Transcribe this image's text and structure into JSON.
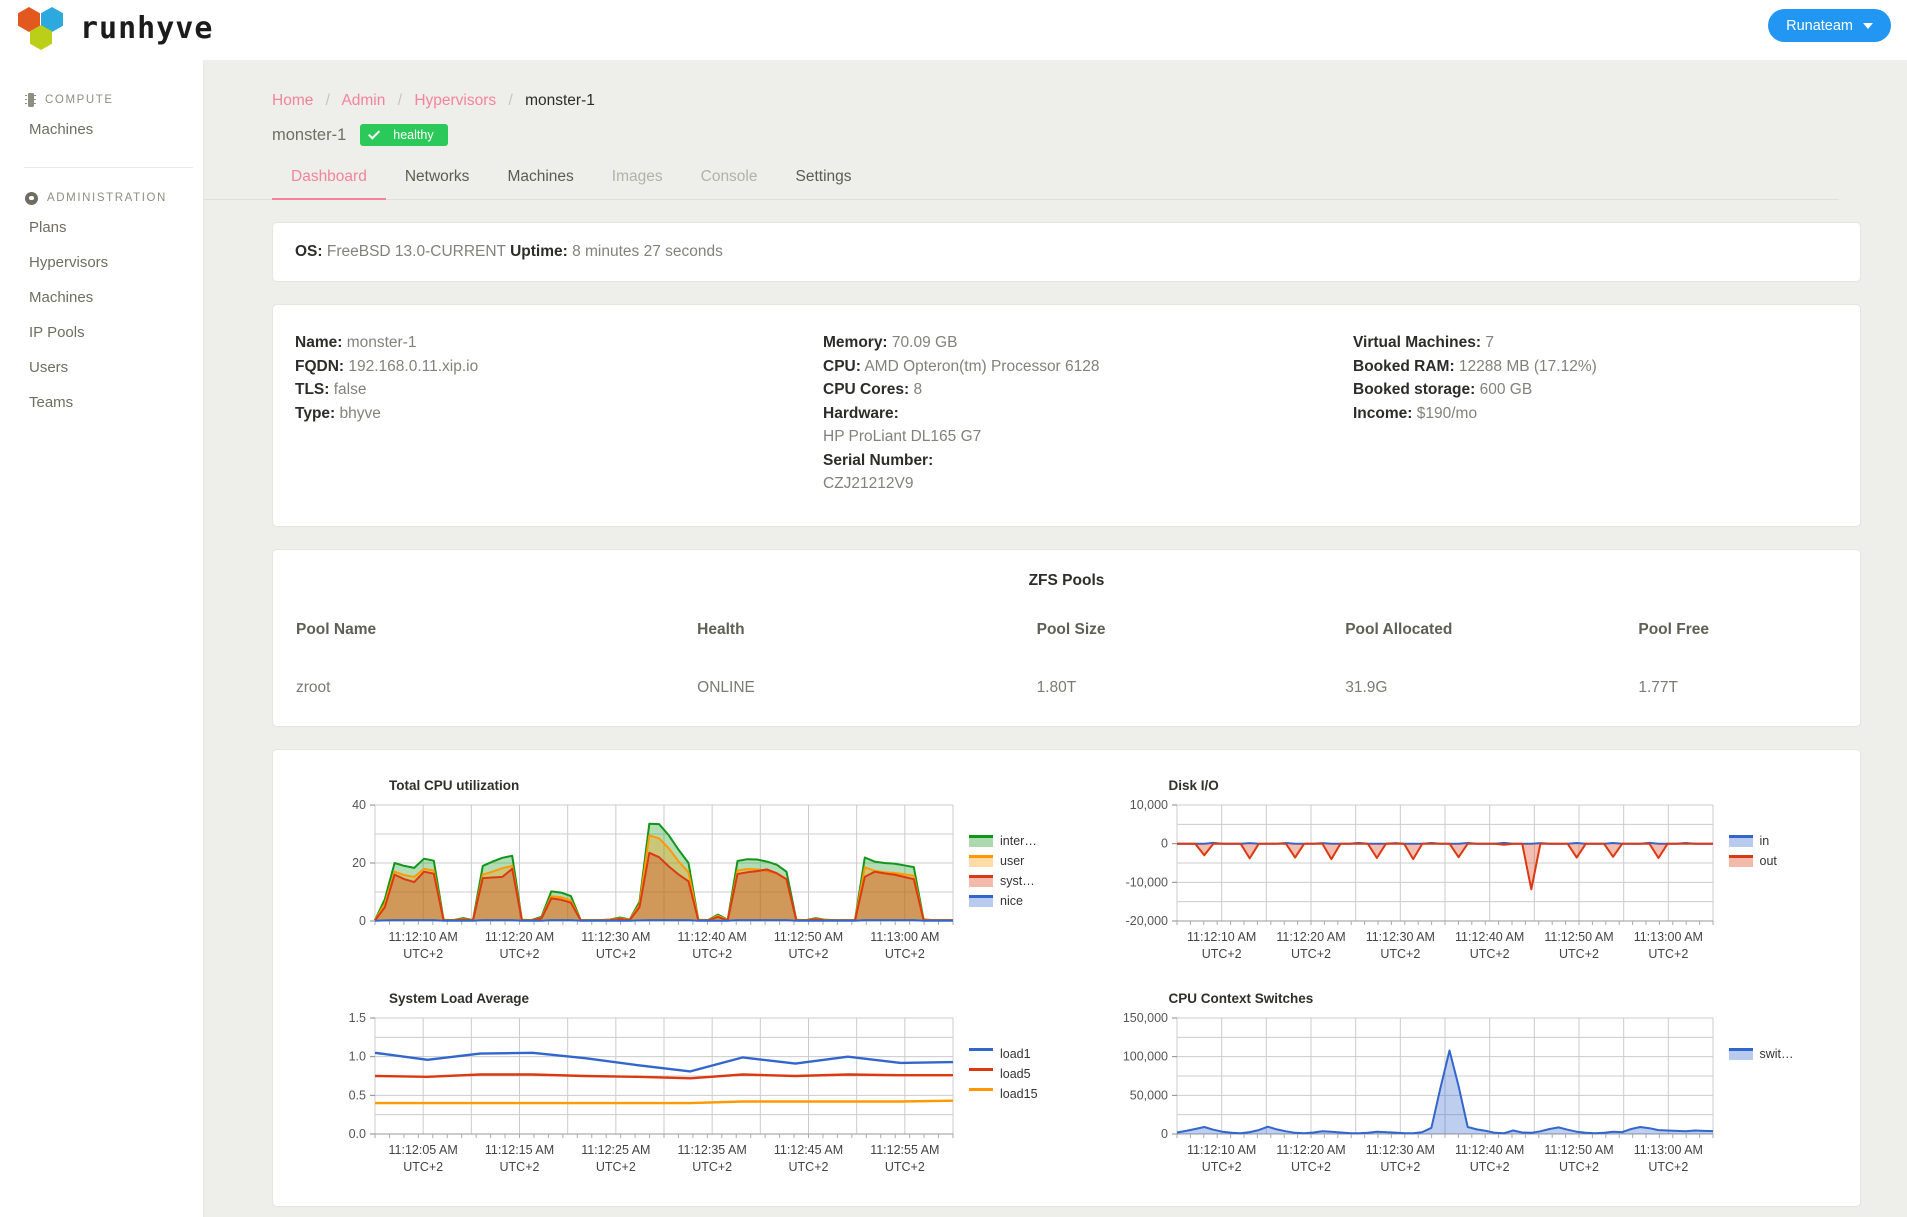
{
  "topbar": {
    "logo_text": "runhyve",
    "team_button": "Runateam"
  },
  "sidebar": {
    "groups": [
      {
        "label": "COMPUTE",
        "icon": "chip-icon",
        "items": [
          {
            "label": "Machines"
          }
        ]
      },
      {
        "label": "ADMINISTRATION",
        "icon": "gear-icon",
        "items": [
          {
            "label": "Plans"
          },
          {
            "label": "Hypervisors"
          },
          {
            "label": "Machines"
          },
          {
            "label": "IP Pools"
          },
          {
            "label": "Users"
          },
          {
            "label": "Teams"
          }
        ]
      }
    ]
  },
  "breadcrumb": {
    "items": [
      "Home",
      "Admin",
      "Hypervisors"
    ],
    "current": "monster-1",
    "separator": "/"
  },
  "header": {
    "name": "monster-1",
    "status_label": "healthy",
    "status_color": "#2bc95a"
  },
  "tabs": [
    {
      "label": "Dashboard",
      "state": "active"
    },
    {
      "label": "Networks",
      "state": "normal"
    },
    {
      "label": "Machines",
      "state": "normal"
    },
    {
      "label": "Images",
      "state": "disabled"
    },
    {
      "label": "Console",
      "state": "disabled"
    },
    {
      "label": "Settings",
      "state": "normal"
    }
  ],
  "os_card": {
    "os_label": "OS:",
    "os_value": "FreeBSD 13.0-CURRENT",
    "uptime_label": "Uptime:",
    "uptime_value": "8 minutes 27 seconds"
  },
  "info_card": {
    "col1": [
      {
        "label": "Name:",
        "value": "monster-1"
      },
      {
        "label": "FQDN:",
        "value": "192.168.0.11.xip.io"
      },
      {
        "label": "TLS:",
        "value": "false"
      },
      {
        "label": "Type:",
        "value": "bhyve"
      }
    ],
    "col2": [
      {
        "label": "Memory:",
        "value": "70.09 GB"
      },
      {
        "label": "CPU:",
        "value": "AMD Opteron(tm) Processor 6128"
      },
      {
        "label": "CPU Cores:",
        "value": "8"
      },
      {
        "label": "Hardware:",
        "value": ""
      },
      {
        "label": "",
        "value": "HP ProLiant DL165 G7"
      },
      {
        "label": "Serial Number:",
        "value": ""
      },
      {
        "label": "",
        "value": "CZJ21212V9"
      }
    ],
    "col3": [
      {
        "label": "Virtual Machines:",
        "value": "7"
      },
      {
        "label": "Booked RAM:",
        "value": "12288 MB (17.12%)"
      },
      {
        "label": "Booked storage:",
        "value": "600 GB"
      },
      {
        "label": "Income:",
        "value": "$190/mo"
      }
    ]
  },
  "zfs": {
    "title": "ZFS Pools",
    "columns": [
      "Pool Name",
      "Health",
      "Pool Size",
      "Pool Allocated",
      "Pool Free"
    ],
    "rows": [
      [
        "zroot",
        "ONLINE",
        "1.80T",
        "31.9G",
        "1.77T"
      ]
    ]
  },
  "chart_data": [
    {
      "id": "cpu",
      "type": "area",
      "title": "Total CPU utilization",
      "stacked": false,
      "ylim": [
        0,
        40
      ],
      "yticks": [
        0,
        20,
        40
      ],
      "yticklabels": [
        "0",
        "20",
        "40"
      ],
      "xticklabels": [
        "11:12:10 AM",
        "11:12:20 AM",
        "11:12:30 AM",
        "11:12:40 AM",
        "11:12:50 AM",
        "11:13:00 AM"
      ],
      "xtick_sub": "UTC+2",
      "legend": [
        {
          "name": "inter…",
          "full": "interrupt",
          "color": "#109618"
        },
        {
          "name": "user",
          "full": "user",
          "color": "#FF9900"
        },
        {
          "name": "syst…",
          "full": "system",
          "color": "#DC3912"
        },
        {
          "name": "nice",
          "full": "nice",
          "color": "#3366CC"
        }
      ],
      "x": [
        0,
        1,
        2,
        3,
        4,
        5,
        6,
        7,
        8,
        9,
        10,
        11,
        12,
        13,
        14,
        15,
        16,
        17,
        18,
        19,
        20,
        21,
        22,
        23,
        24,
        25,
        26,
        27,
        28,
        29,
        30,
        31,
        32,
        33,
        34,
        35,
        36,
        37,
        38,
        39,
        40,
        41,
        42,
        43,
        44,
        45,
        46,
        47,
        48,
        49,
        50,
        51,
        52,
        53,
        54,
        55,
        56,
        57,
        58,
        59
      ],
      "series": [
        {
          "name": "inter…",
          "color": "#109618",
          "values": [
            0.3,
            7.5,
            20.0,
            19.0,
            18.3,
            21.5,
            20.8,
            0.4,
            0.3,
            1.0,
            0.3,
            19.0,
            20.5,
            21.8,
            22.5,
            0.4,
            0.3,
            1.5,
            10.2,
            9.8,
            8.6,
            0.3,
            0.3,
            0.3,
            0.5,
            1.2,
            0.5,
            6.6,
            33.5,
            33.4,
            29.5,
            24.5,
            20.0,
            0.4,
            0.3,
            2.2,
            0.4,
            20.7,
            21.3,
            21.2,
            20.5,
            19.4,
            17.0,
            0.4,
            0.3,
            1.0,
            0.4,
            0.3,
            0.3,
            0.3,
            21.9,
            20.5,
            20.0,
            19.8,
            19.2,
            18.6,
            0.5,
            0.3,
            0.3,
            0.3
          ]
        },
        {
          "name": "user",
          "color": "#FF9900",
          "values": [
            0.2,
            6.0,
            17.0,
            15.8,
            15.2,
            18.0,
            17.4,
            0.3,
            0.2,
            0.7,
            0.2,
            16.0,
            17.0,
            18.2,
            19.0,
            0.3,
            0.2,
            1.1,
            8.5,
            8.2,
            7.1,
            0.2,
            0.2,
            0.2,
            0.4,
            0.9,
            0.4,
            5.6,
            29.5,
            28.5,
            25.0,
            20.5,
            16.8,
            0.3,
            0.2,
            1.8,
            0.3,
            17.4,
            17.9,
            17.8,
            17.2,
            16.4,
            14.3,
            0.3,
            0.2,
            0.8,
            0.3,
            0.2,
            0.2,
            0.2,
            18.5,
            17.3,
            16.8,
            16.6,
            16.1,
            15.6,
            0.4,
            0.2,
            0.2,
            0.2
          ]
        },
        {
          "name": "syst…",
          "color": "#DC3912",
          "values": [
            0.2,
            4.7,
            16.0,
            14.4,
            13.4,
            17.0,
            16.3,
            0.2,
            0.2,
            0.5,
            0.2,
            14.8,
            15.0,
            15.2,
            18.0,
            0.2,
            0.2,
            0.9,
            7.8,
            7.3,
            6.3,
            0.2,
            0.2,
            0.2,
            0.3,
            0.7,
            0.3,
            4.8,
            23.5,
            22.0,
            18.8,
            16.0,
            13.7,
            0.2,
            0.2,
            1.4,
            0.2,
            16.2,
            16.8,
            17.2,
            17.8,
            16.5,
            14.4,
            0.2,
            0.2,
            0.6,
            0.2,
            0.2,
            0.2,
            0.2,
            15.2,
            17.0,
            16.4,
            16.0,
            15.2,
            14.4,
            0.3,
            0.2,
            0.2,
            0.2
          ]
        },
        {
          "name": "nice",
          "color": "#3366CC",
          "values": [
            0.1,
            0.2,
            0.3,
            0.3,
            0.3,
            0.3,
            0.3,
            0.1,
            0.1,
            0.1,
            0.1,
            0.3,
            0.3,
            0.3,
            0.3,
            0.1,
            0.1,
            0.1,
            0.3,
            0.3,
            0.3,
            0.1,
            0.1,
            0.1,
            0.1,
            0.1,
            0.1,
            0.2,
            0.3,
            0.3,
            0.3,
            0.3,
            0.3,
            0.1,
            0.1,
            0.1,
            0.1,
            0.3,
            0.3,
            0.3,
            0.3,
            0.3,
            0.3,
            0.1,
            0.1,
            0.1,
            0.1,
            0.1,
            0.1,
            0.1,
            0.3,
            0.3,
            0.3,
            0.3,
            0.3,
            0.3,
            0.1,
            0.1,
            0.1,
            0.1
          ]
        }
      ]
    },
    {
      "id": "diskio",
      "type": "area",
      "title": "Disk I/O",
      "ylim": [
        -20000,
        10000
      ],
      "yticks": [
        -20000,
        -10000,
        0,
        10000
      ],
      "yticklabels": [
        "-20,000",
        "-10,000",
        "0",
        "10,000"
      ],
      "xticklabels": [
        "11:12:10 AM",
        "11:12:20 AM",
        "11:12:30 AM",
        "11:12:40 AM",
        "11:12:50 AM",
        "11:13:00 AM"
      ],
      "xtick_sub": "UTC+2",
      "legend": [
        {
          "name": "in",
          "color": "#3366CC"
        },
        {
          "name": "out",
          "color": "#DC3912"
        }
      ],
      "series": [
        {
          "name": "in",
          "color": "#3366CC",
          "values": [
            0,
            0,
            0,
            0,
            200,
            0,
            0,
            0,
            150,
            0,
            0,
            0,
            180,
            0,
            0,
            0,
            150,
            0,
            0,
            0,
            200,
            0,
            0,
            0,
            150,
            0,
            0,
            0,
            180,
            0,
            0,
            0,
            160,
            0,
            0,
            0,
            200,
            0,
            0,
            0,
            150,
            0,
            0,
            0,
            180,
            0,
            0,
            0,
            160,
            0,
            0,
            0,
            190,
            0,
            0,
            0,
            160,
            0,
            0,
            0
          ]
        },
        {
          "name": "out",
          "color": "#DC3912",
          "values": [
            0,
            0,
            0,
            -3000,
            0,
            0,
            0,
            0,
            -3800,
            0,
            0,
            0,
            0,
            -3600,
            0,
            0,
            0,
            -4000,
            0,
            0,
            0,
            0,
            -3700,
            0,
            0,
            0,
            -4000,
            0,
            0,
            0,
            0,
            -3500,
            0,
            0,
            0,
            0,
            -300,
            0,
            0,
            -11800,
            0,
            0,
            0,
            0,
            -3600,
            0,
            0,
            0,
            -3400,
            0,
            0,
            0,
            0,
            -3700,
            0,
            0,
            0,
            0,
            0,
            0
          ]
        }
      ]
    },
    {
      "id": "load",
      "type": "line",
      "title": "System Load Average",
      "ylim": [
        0.0,
        1.5
      ],
      "yticks": [
        0.0,
        0.5,
        1.0,
        1.5
      ],
      "yticklabels": [
        "0.0",
        "0.5",
        "1.0",
        "1.5"
      ],
      "xticklabels": [
        "11:12:05 AM",
        "11:12:15 AM",
        "11:12:25 AM",
        "11:12:35 AM",
        "11:12:45 AM",
        "11:12:55 AM"
      ],
      "xtick_sub": "UTC+2",
      "legend": [
        {
          "name": "load1",
          "color": "#3366CC"
        },
        {
          "name": "load5",
          "color": "#DC3912"
        },
        {
          "name": "load15",
          "color": "#FF9900"
        }
      ],
      "series": [
        {
          "name": "load1",
          "color": "#3366CC",
          "values": [
            1.05,
            0.96,
            1.04,
            1.05,
            0.98,
            0.89,
            0.81,
            0.99,
            0.91,
            1.0,
            0.92,
            0.93
          ]
        },
        {
          "name": "load5",
          "color": "#DC3912",
          "values": [
            0.75,
            0.74,
            0.77,
            0.77,
            0.75,
            0.74,
            0.72,
            0.77,
            0.75,
            0.77,
            0.76,
            0.76
          ]
        },
        {
          "name": "load15",
          "color": "#FF9900",
          "values": [
            0.4,
            0.4,
            0.4,
            0.4,
            0.4,
            0.4,
            0.4,
            0.42,
            0.42,
            0.42,
            0.42,
            0.43
          ]
        }
      ]
    },
    {
      "id": "ctxsw",
      "type": "area",
      "title": "CPU Context Switches",
      "ylim": [
        0,
        150000
      ],
      "yticks": [
        0,
        50000,
        100000,
        150000
      ],
      "yticklabels": [
        "0",
        "50,000",
        "100,000",
        "150,000"
      ],
      "xticklabels": [
        "11:12:10 AM",
        "11:12:20 AM",
        "11:12:30 AM",
        "11:12:40 AM",
        "11:12:50 AM",
        "11:13:00 AM"
      ],
      "xtick_sub": "UTC+2",
      "legend": [
        {
          "name": "swit…",
          "full": "switches",
          "color": "#3366CC"
        }
      ],
      "series": [
        {
          "name": "swit…",
          "color": "#3366CC",
          "values": [
            2000,
            4000,
            6500,
            9000,
            5500,
            3000,
            1500,
            1000,
            2500,
            5000,
            9500,
            6000,
            3500,
            1500,
            1000,
            2000,
            3500,
            3000,
            2000,
            1200,
            900,
            1500,
            3000,
            2500,
            1800,
            1200,
            900,
            2500,
            8000,
            60000,
            108000,
            62000,
            9000,
            6000,
            4000,
            1500,
            1000,
            4500,
            2000,
            1500,
            3500,
            6500,
            8500,
            5500,
            3000,
            1500,
            1000,
            1500,
            3000,
            2500,
            6500,
            9000,
            7500,
            5000,
            4500,
            4000,
            3500,
            4500,
            4000,
            3800
          ]
        }
      ]
    }
  ]
}
